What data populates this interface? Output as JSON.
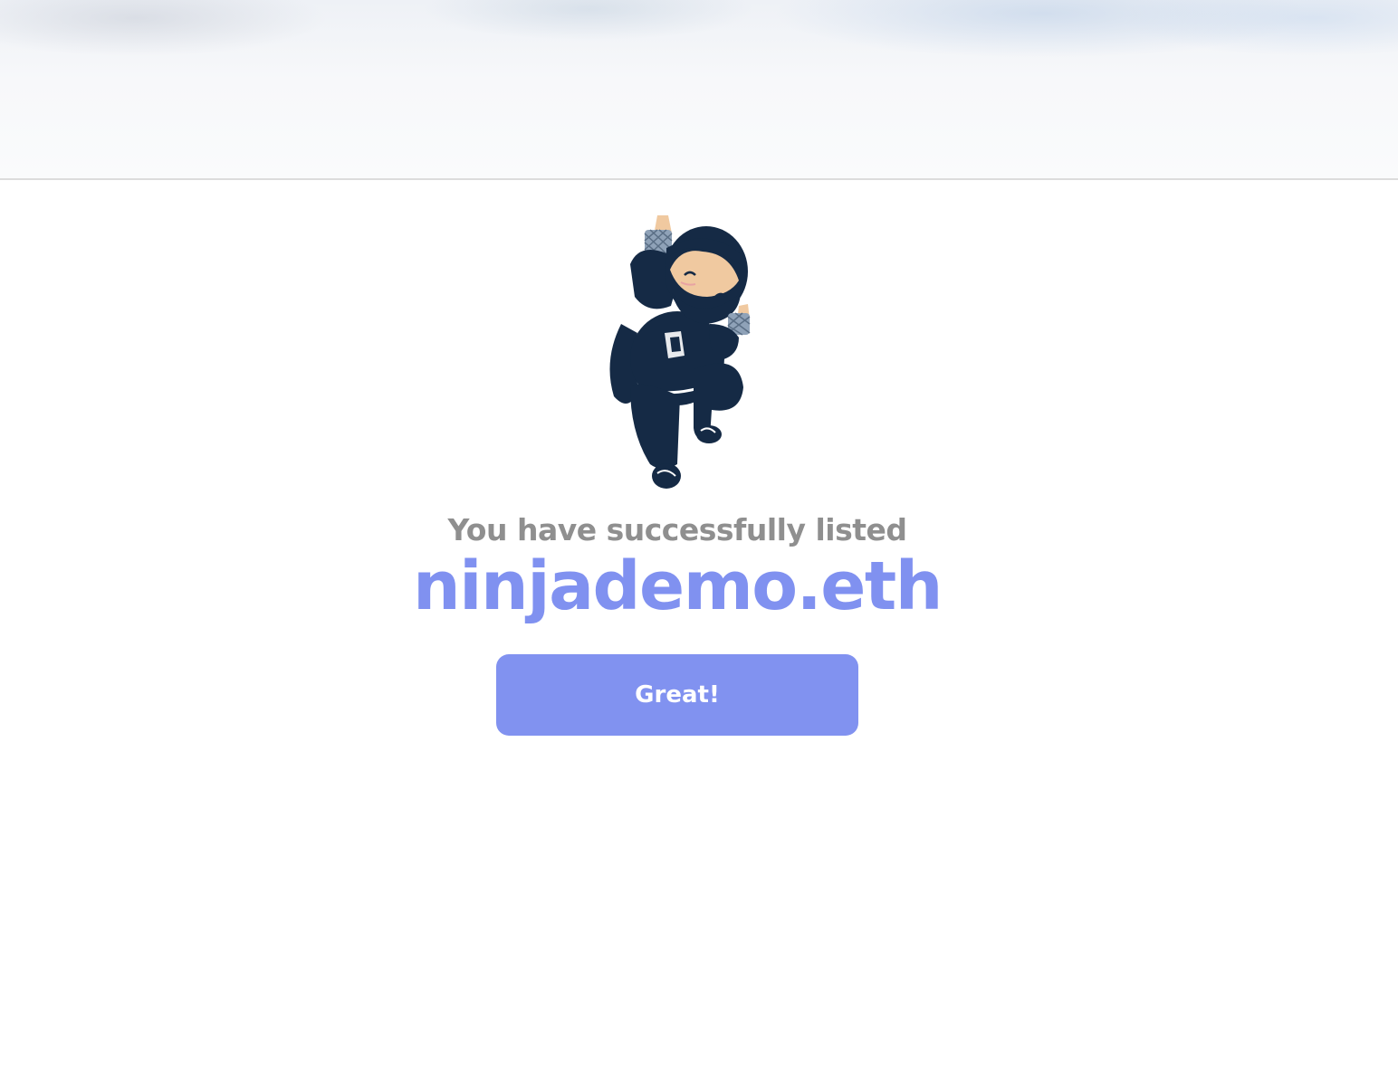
{
  "header": {
    "banner": "decorative-blurred-banner"
  },
  "main": {
    "mascot_icon": "ninja-mascot-icon",
    "success_message": "You have successfully listed",
    "domain_name": "ninjademo.eth",
    "great_button_label": "Great!"
  },
  "colors": {
    "accent": "#8192f0",
    "muted_text": "#8f8f8f",
    "ninja_navy": "#152a45",
    "skin": "#f0c9a0"
  }
}
